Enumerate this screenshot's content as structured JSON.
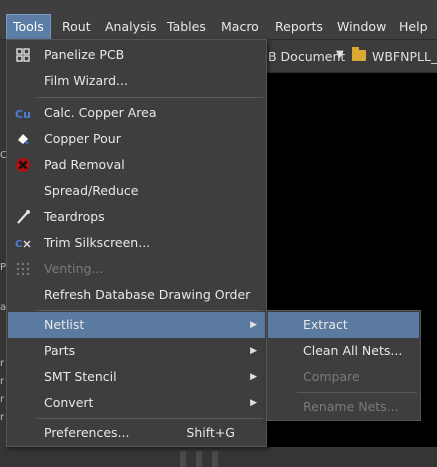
{
  "menubar": {
    "items": [
      {
        "label": "Tools",
        "active": true
      },
      {
        "label": "Rout"
      },
      {
        "label": "Analysis"
      },
      {
        "label": "Tables"
      },
      {
        "label": "Macro"
      },
      {
        "label": "Reports"
      },
      {
        "label": "Window"
      },
      {
        "label": "Help"
      }
    ]
  },
  "document": {
    "type_label": "B Document",
    "file_name": "WBFNPLL_tes"
  },
  "tools_menu": {
    "items": [
      {
        "label": "Panelize PCB",
        "icon": "panelize-icon"
      },
      {
        "label": "Film Wizard..."
      },
      {
        "label": "Calc. Copper Area",
        "icon": "calc-copper-icon"
      },
      {
        "label": "Copper Pour",
        "icon": "copper-pour-icon"
      },
      {
        "label": "Pad Removal",
        "icon": "pad-removal-icon"
      },
      {
        "label": "Spread/Reduce"
      },
      {
        "label": "Teardrops",
        "icon": "teardrops-icon"
      },
      {
        "label": "Trim Silkscreen...",
        "icon": "trim-silkscreen-icon"
      },
      {
        "label": "Venting...",
        "icon": "venting-icon",
        "disabled": true
      },
      {
        "label": "Refresh Database Drawing Order"
      },
      {
        "label": "Netlist",
        "submenu": true,
        "highlighted": true
      },
      {
        "label": "Parts",
        "submenu": true
      },
      {
        "label": "SMT Stencil",
        "submenu": true
      },
      {
        "label": "Convert",
        "submenu": true
      },
      {
        "label": "Preferences...",
        "shortcut": "Shift+G"
      }
    ]
  },
  "netlist_submenu": {
    "items": [
      {
        "label": "Extract",
        "highlighted": true
      },
      {
        "label": "Clean All Nets..."
      },
      {
        "label": "Compare",
        "disabled": true
      },
      {
        "label": "Rename Nets...",
        "disabled": true
      }
    ]
  },
  "colors": {
    "highlight": "#5a7aa0",
    "menu_bg": "#3e3e3e",
    "canvas_bg": "#000000",
    "disabled_text": "#7a7a7a"
  }
}
